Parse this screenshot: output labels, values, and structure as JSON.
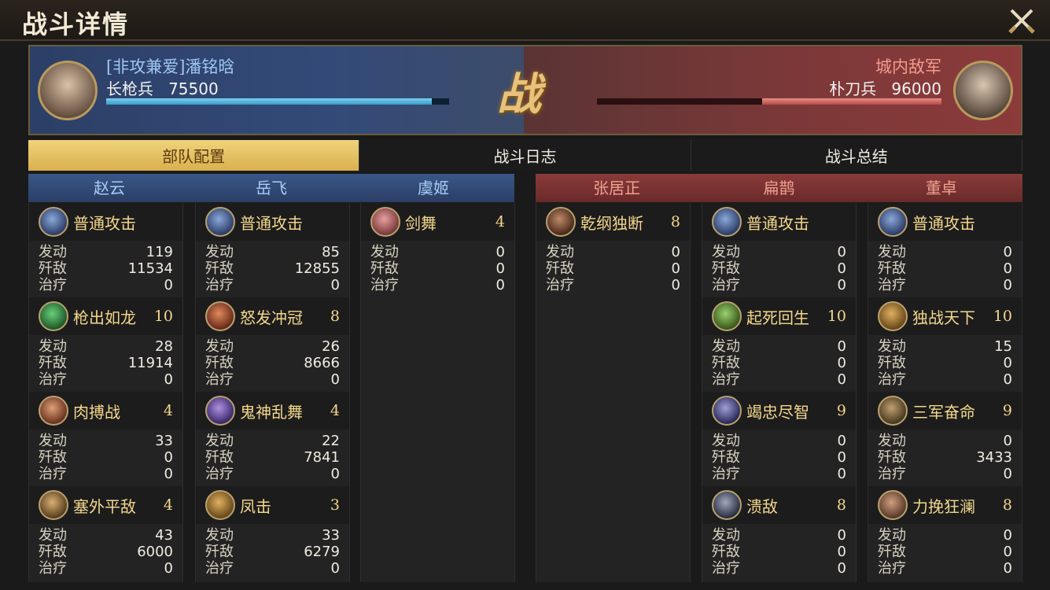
{
  "title": "战斗详情",
  "left_side": {
    "name": "[非攻兼爱]潘铭晗",
    "troop_type": "长枪兵",
    "troop_count": "75500",
    "hp_fraction": 0.95
  },
  "right_side": {
    "name": "城内敌军",
    "troop_type": "朴刀兵",
    "troop_count": "96000",
    "hp_fraction": 0.52
  },
  "battle_glyph": "战",
  "tabs": [
    "部队配置",
    "战斗日志",
    "战斗总结"
  ],
  "stat_labels": [
    "发动",
    "歼敌",
    "治疗"
  ],
  "generals": [
    {
      "name": "赵云",
      "side": "left",
      "skills": [
        {
          "name": "普通攻击",
          "level": "",
          "stats": [
            "119",
            "11534",
            "0"
          ]
        },
        {
          "name": "枪出如龙",
          "level": "10",
          "stats": [
            "28",
            "11914",
            "0"
          ]
        },
        {
          "name": "肉搏战",
          "level": "4",
          "stats": [
            "33",
            "0",
            "0"
          ]
        },
        {
          "name": "塞外平敌",
          "level": "4",
          "stats": [
            "43",
            "6000",
            "0"
          ]
        }
      ]
    },
    {
      "name": "岳飞",
      "side": "left",
      "skills": [
        {
          "name": "普通攻击",
          "level": "",
          "stats": [
            "85",
            "12855",
            "0"
          ]
        },
        {
          "name": "怒发冲冠",
          "level": "8",
          "stats": [
            "26",
            "8666",
            "0"
          ]
        },
        {
          "name": "鬼神乱舞",
          "level": "4",
          "stats": [
            "22",
            "7841",
            "0"
          ]
        },
        {
          "name": "凤击",
          "level": "3",
          "stats": [
            "33",
            "6279",
            "0"
          ]
        }
      ]
    },
    {
      "name": "虞姬",
      "side": "left",
      "skills": [
        {
          "name": "剑舞",
          "level": "4",
          "stats": [
            "0",
            "0",
            "0"
          ]
        }
      ]
    },
    {
      "name": "张居正",
      "side": "right",
      "skills": [
        {
          "name": "乾纲独断",
          "level": "8",
          "stats": [
            "0",
            "0",
            "0"
          ]
        }
      ]
    },
    {
      "name": "扁鹊",
      "side": "right",
      "skills": [
        {
          "name": "普通攻击",
          "level": "",
          "stats": [
            "0",
            "0",
            "0"
          ]
        },
        {
          "name": "起死回生",
          "level": "10",
          "stats": [
            "0",
            "0",
            "0"
          ]
        },
        {
          "name": "竭忠尽智",
          "level": "9",
          "stats": [
            "0",
            "0",
            "0"
          ]
        },
        {
          "name": "溃敌",
          "level": "8",
          "stats": [
            "0",
            "0",
            "0"
          ]
        }
      ]
    },
    {
      "name": "董卓",
      "side": "right",
      "skills": [
        {
          "name": "普通攻击",
          "level": "",
          "stats": [
            "0",
            "0",
            "0"
          ]
        },
        {
          "name": "独战天下",
          "level": "10",
          "stats": [
            "15",
            "0",
            "0"
          ]
        },
        {
          "name": "三军奋命",
          "level": "9",
          "stats": [
            "0",
            "3433",
            "0"
          ]
        },
        {
          "name": "力挽狂澜",
          "level": "8",
          "stats": [
            "0",
            "0",
            "0"
          ]
        }
      ]
    }
  ],
  "colors": {
    "accent_gold": "#f4d78c",
    "ally_blue": "#334a78",
    "enemy_red": "#7a3838"
  }
}
